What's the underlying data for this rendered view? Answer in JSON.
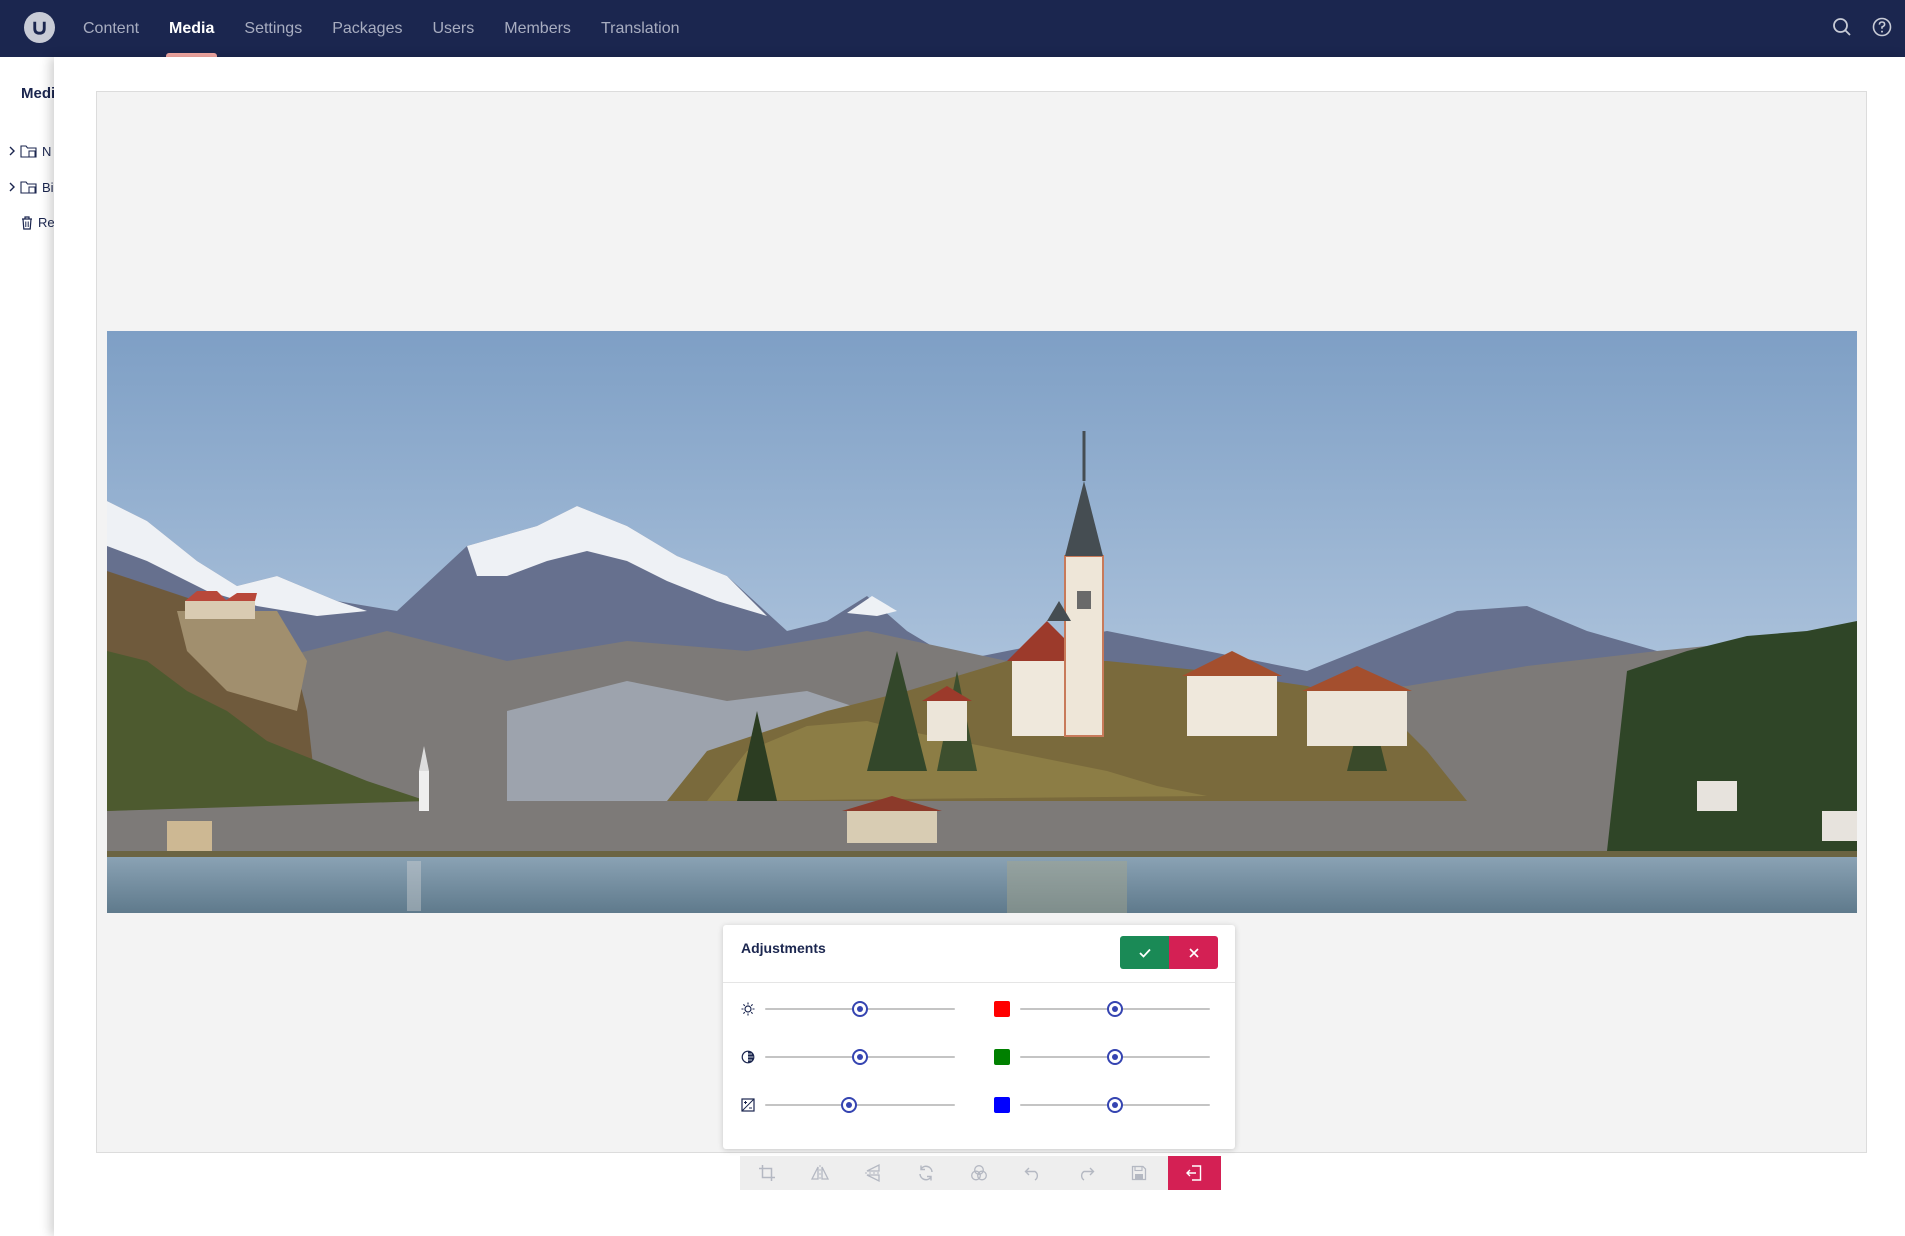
{
  "nav": {
    "items": [
      {
        "label": "Content",
        "active": false
      },
      {
        "label": "Media",
        "active": true
      },
      {
        "label": "Settings",
        "active": false
      },
      {
        "label": "Packages",
        "active": false
      },
      {
        "label": "Users",
        "active": false
      },
      {
        "label": "Members",
        "active": false
      },
      {
        "label": "Translation",
        "active": false
      }
    ],
    "right_icons": [
      "search-icon",
      "help-icon"
    ]
  },
  "sidebar": {
    "title": "Medi",
    "items": [
      {
        "label": "N",
        "icon": "media-folder-icon",
        "expandable": true
      },
      {
        "label": "Bi",
        "icon": "media-folder-icon",
        "expandable": true
      },
      {
        "label": "Re",
        "icon": "trash-icon",
        "expandable": false
      }
    ]
  },
  "editor": {
    "image_subject": "lake-island-church-mountains-photo",
    "adjustments": {
      "title": "Adjustments",
      "confirm_icon": "check-icon",
      "cancel_icon": "close-icon",
      "sliders": [
        {
          "name": "brightness",
          "icon": "brightness-icon",
          "value": 0.5
        },
        {
          "name": "contrast",
          "icon": "contrast-icon",
          "value": 0.5
        },
        {
          "name": "exposure",
          "icon": "exposure-icon",
          "value": 0.44
        },
        {
          "name": "red",
          "color": "#ff0000",
          "value": 0.5
        },
        {
          "name": "green",
          "color": "#008000",
          "value": 0.5
        },
        {
          "name": "blue",
          "color": "#0000ff",
          "value": 0.5
        }
      ]
    },
    "toolbar": [
      "crop-icon",
      "flip-horizontal-icon",
      "flip-vertical-icon",
      "rotate-icon",
      "adjust-colors-icon",
      "undo-icon",
      "redo-icon",
      "save-icon",
      "exit-icon"
    ]
  },
  "colors": {
    "topbar": "#1b264f",
    "accent_pink": "#d42054",
    "confirm_green": "#1a8a56",
    "slider_blue": "#3544b1"
  }
}
